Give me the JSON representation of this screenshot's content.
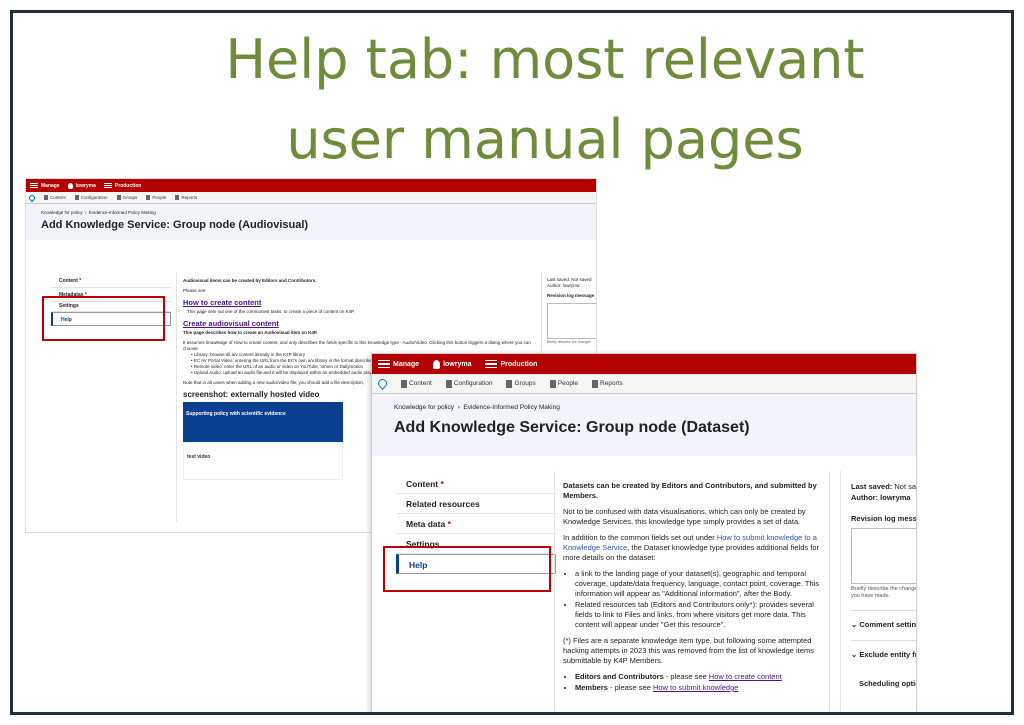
{
  "slide": {
    "title_line1": "Help tab: most relevant",
    "title_line2": "user manual pages"
  },
  "shot1": {
    "toolbar": {
      "manage": "Manage",
      "user": "lowryma",
      "env": "Production"
    },
    "tray": [
      "Content",
      "Configuration",
      "Groups",
      "People",
      "Reports"
    ],
    "breadcrumb": [
      "Knowledge for policy",
      "Evidence-Informed Policy Making"
    ],
    "title": "Add Knowledge Service: Group node (Audiovisual)",
    "tabs": [
      "Content",
      "Metadatas",
      "Settings",
      "Help"
    ],
    "body": {
      "intro": "Audiovisual items can be created by Editors and Contributors.",
      "please_see": "Please see:",
      "link1": "How to create content",
      "link1_desc": "This page sets out one of the commonest tasks: to create a piece of content on K4P.",
      "link2": "Create audiovisual content",
      "link2_desc": "This page describes how to create an Audiovisual item on K4P.",
      "assumes": "It assumes knowledge of How to create content, and only describes the fields specific to this knowledge type - Audio/Video. Clicking this button triggers a dialog where you can choose:",
      "bullets": [
        "Library: browse all a/v content already in the K4P library",
        "EC AV Portal Video: entering the URL from the EC's own a/v library in the format described",
        "Remote video: enter the URL of an audio or video on YouTube, Vimeo or Dailymotion",
        "Upload Audio: upload an audio file and it will be displayed within an embedded audio player"
      ],
      "note": "Note that in all cases when adding a new audio/video file, you should add a file description,",
      "screenshot_heading": "screenshot: externally hosted video",
      "thumb_title": "Supporting policy with scientific evidence",
      "thumb_small": "test video"
    },
    "side": {
      "last_saved": "Last saved: Not saved",
      "author": "Author: lowryma",
      "revision": "Revision log message",
      "hint": "Briefly describe the changes"
    }
  },
  "shot2": {
    "toolbar": {
      "manage": "Manage",
      "user": "lowryma",
      "env": "Production"
    },
    "tray": [
      "Content",
      "Configuration",
      "Groups",
      "People",
      "Reports"
    ],
    "breadcrumb": [
      "Knowledge for policy",
      "Evidence-Informed Policy Making"
    ],
    "title": "Add Knowledge Service: Group node (Dataset)",
    "tabs": [
      {
        "label": "Content",
        "required": "*"
      },
      {
        "label": "Related resources",
        "required": ""
      },
      {
        "label": "Meta data",
        "required": "*"
      },
      {
        "label": "Settings",
        "required": ""
      },
      {
        "label": "Help",
        "required": ""
      }
    ],
    "body": {
      "p1": "Datasets can be created by Editors and Contributors, and submitted by Members.",
      "p2": "Not to be confused with data visualisations, which can only be created by Knowledge Services, this knowledge type simply provides a set of data.",
      "p3_a": "In addition to the common fields set out under ",
      "p3_link": "How to submit knowledge to a Knowledge Service",
      "p3_b": ", the Dataset knowledge type provides additional fields for more details on the dataset:",
      "bullets": [
        "a link to the landing page of your dataset(s), geographic and temporal coverage, update/data frequency, language, contact point, coverage. This information will appear as \"Additional information\", after the Body.",
        "Related resources tab (Editors and Contributors only*): provides several fields to link to Files and links, from where visitors get more data. This content will appear under \"Get this resource\"."
      ],
      "p4": "(*) Files are a separate knowledge item type, but following some attempted hacking attempts in 2023 this was removed from the list of knowledge items submittable by K4P Members.",
      "see1_bold": "Editors and Contributors",
      "see1_text": " - please see ",
      "see1_link": "How to create content",
      "see2_bold": "Members",
      "see2_text": " - please see ",
      "see2_link": "How to submit knowledge"
    },
    "side": {
      "last_saved_label": "Last saved:",
      "last_saved_value": "Not saved",
      "author": "Author: lowryma",
      "revision": "Revision log message",
      "hint": "Briefly describe the changes you have made.",
      "acc1": "Comment settings",
      "acc2": "Exclude entity from",
      "acc3": "Scheduling options"
    }
  }
}
